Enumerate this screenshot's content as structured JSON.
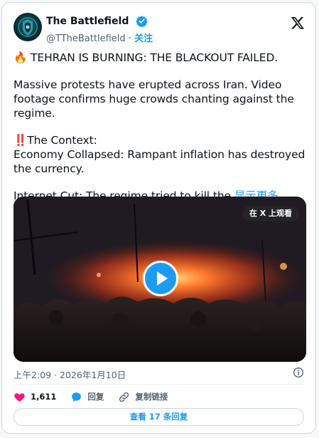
{
  "author": {
    "name": "The Battlefield",
    "handle": "@TTheBattlefield",
    "separator": "·",
    "follow_label": "关注"
  },
  "tweet": {
    "headline_emoji": "🔥",
    "headline": "TEHRAN IS BURNING: THE BLACKOUT FAILED.",
    "para1": "Massive protests have erupted across Iran. Video footage confirms huge crowds chanting against the regime.",
    "context_emoji": "‼️",
    "context_heading": "The Context:",
    "context_line": "Economy Collapsed: Rampant inflation has destroyed the currency.",
    "internet_line": "Internet Cut: The regime tried to kill the",
    "show_more": "显示更多"
  },
  "media": {
    "watch_on_x_label": "在 X 上观看"
  },
  "meta": {
    "time": "上午2:09",
    "separator": "·",
    "date": "2026年1月10日"
  },
  "actions": {
    "like_count": "1,611",
    "reply_label": "回复",
    "copy_link_label": "复制链接"
  },
  "replies_button": "查看 17 条回复",
  "colors": {
    "accent": "#1d9bf0",
    "like": "#f91880",
    "text": "#0f1419",
    "muted": "#536471"
  }
}
